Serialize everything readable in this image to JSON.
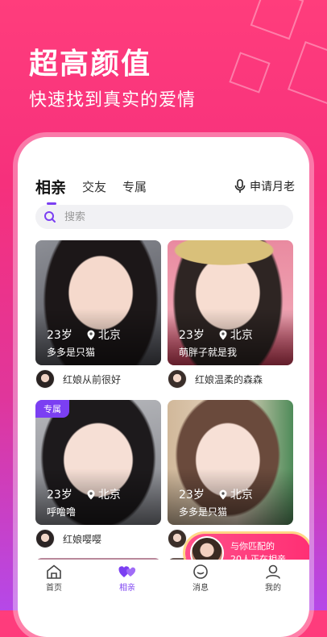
{
  "promo": {
    "headline": "超高颜值",
    "subline": "快速找到真实的爱情"
  },
  "tabs": [
    {
      "label": "相亲",
      "active": true
    },
    {
      "label": "交友",
      "active": false
    },
    {
      "label": "专属",
      "active": false
    }
  ],
  "apply_label": "申请月老",
  "search": {
    "placeholder": "搜索",
    "value": ""
  },
  "cards": [
    {
      "age": "23岁",
      "city": "北京",
      "bio": "多多是只猫",
      "matchmaker": "红娘从前很好",
      "badge": ""
    },
    {
      "age": "23岁",
      "city": "北京",
      "bio": "萌胖子就是我",
      "matchmaker": "红娘温柔的森森",
      "badge": ""
    },
    {
      "age": "23岁",
      "city": "北京",
      "bio": "呼噜噜",
      "matchmaker": "红娘嘤嘤",
      "badge": "专属"
    },
    {
      "age": "23岁",
      "city": "北京",
      "bio": "多多是只猫",
      "matchmaker": "",
      "badge": ""
    }
  ],
  "float": {
    "line1": "与你匹配的",
    "line2": "20人正在相亲"
  },
  "nav": [
    {
      "label": "首页",
      "icon": "home-icon"
    },
    {
      "label": "相亲",
      "icon": "hearts-icon"
    },
    {
      "label": "消息",
      "icon": "chat-icon"
    },
    {
      "label": "我的",
      "icon": "user-icon"
    }
  ],
  "colors": {
    "accent": "#7b3ff2",
    "brand_pink": "#ff2f74"
  }
}
